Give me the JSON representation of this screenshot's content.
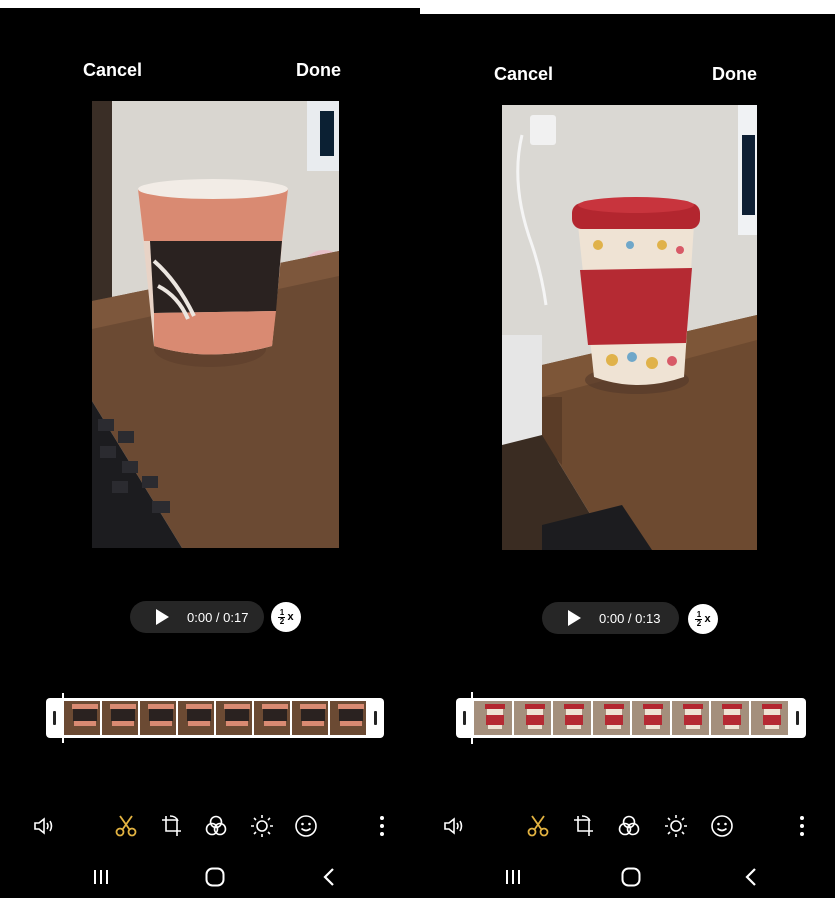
{
  "screens": [
    {
      "cancel_label": "Cancel",
      "done_label": "Done",
      "playback": {
        "time": "0:00 / 0:17",
        "speed_whole": "x",
        "speed_num": "1",
        "speed_den": "2"
      },
      "theme": {
        "accent": "#e3b341",
        "subject": "mug-white-red-black"
      }
    },
    {
      "cancel_label": "Cancel",
      "done_label": "Done",
      "playback": {
        "time": "0:00 / 0:13",
        "speed_whole": "x",
        "speed_num": "1",
        "speed_den": "2"
      },
      "theme": {
        "accent": "#e3b341",
        "subject": "cup-red-lid"
      }
    }
  ],
  "toolbar": {
    "icons": [
      "volume-icon",
      "scissors-icon",
      "crop-rotate-icon",
      "filter-icon",
      "brightness-icon",
      "sticker-icon",
      "more-icon"
    ],
    "active": "scissors-icon"
  },
  "navbar": {
    "icons": [
      "recents-icon",
      "home-icon",
      "back-icon"
    ]
  }
}
